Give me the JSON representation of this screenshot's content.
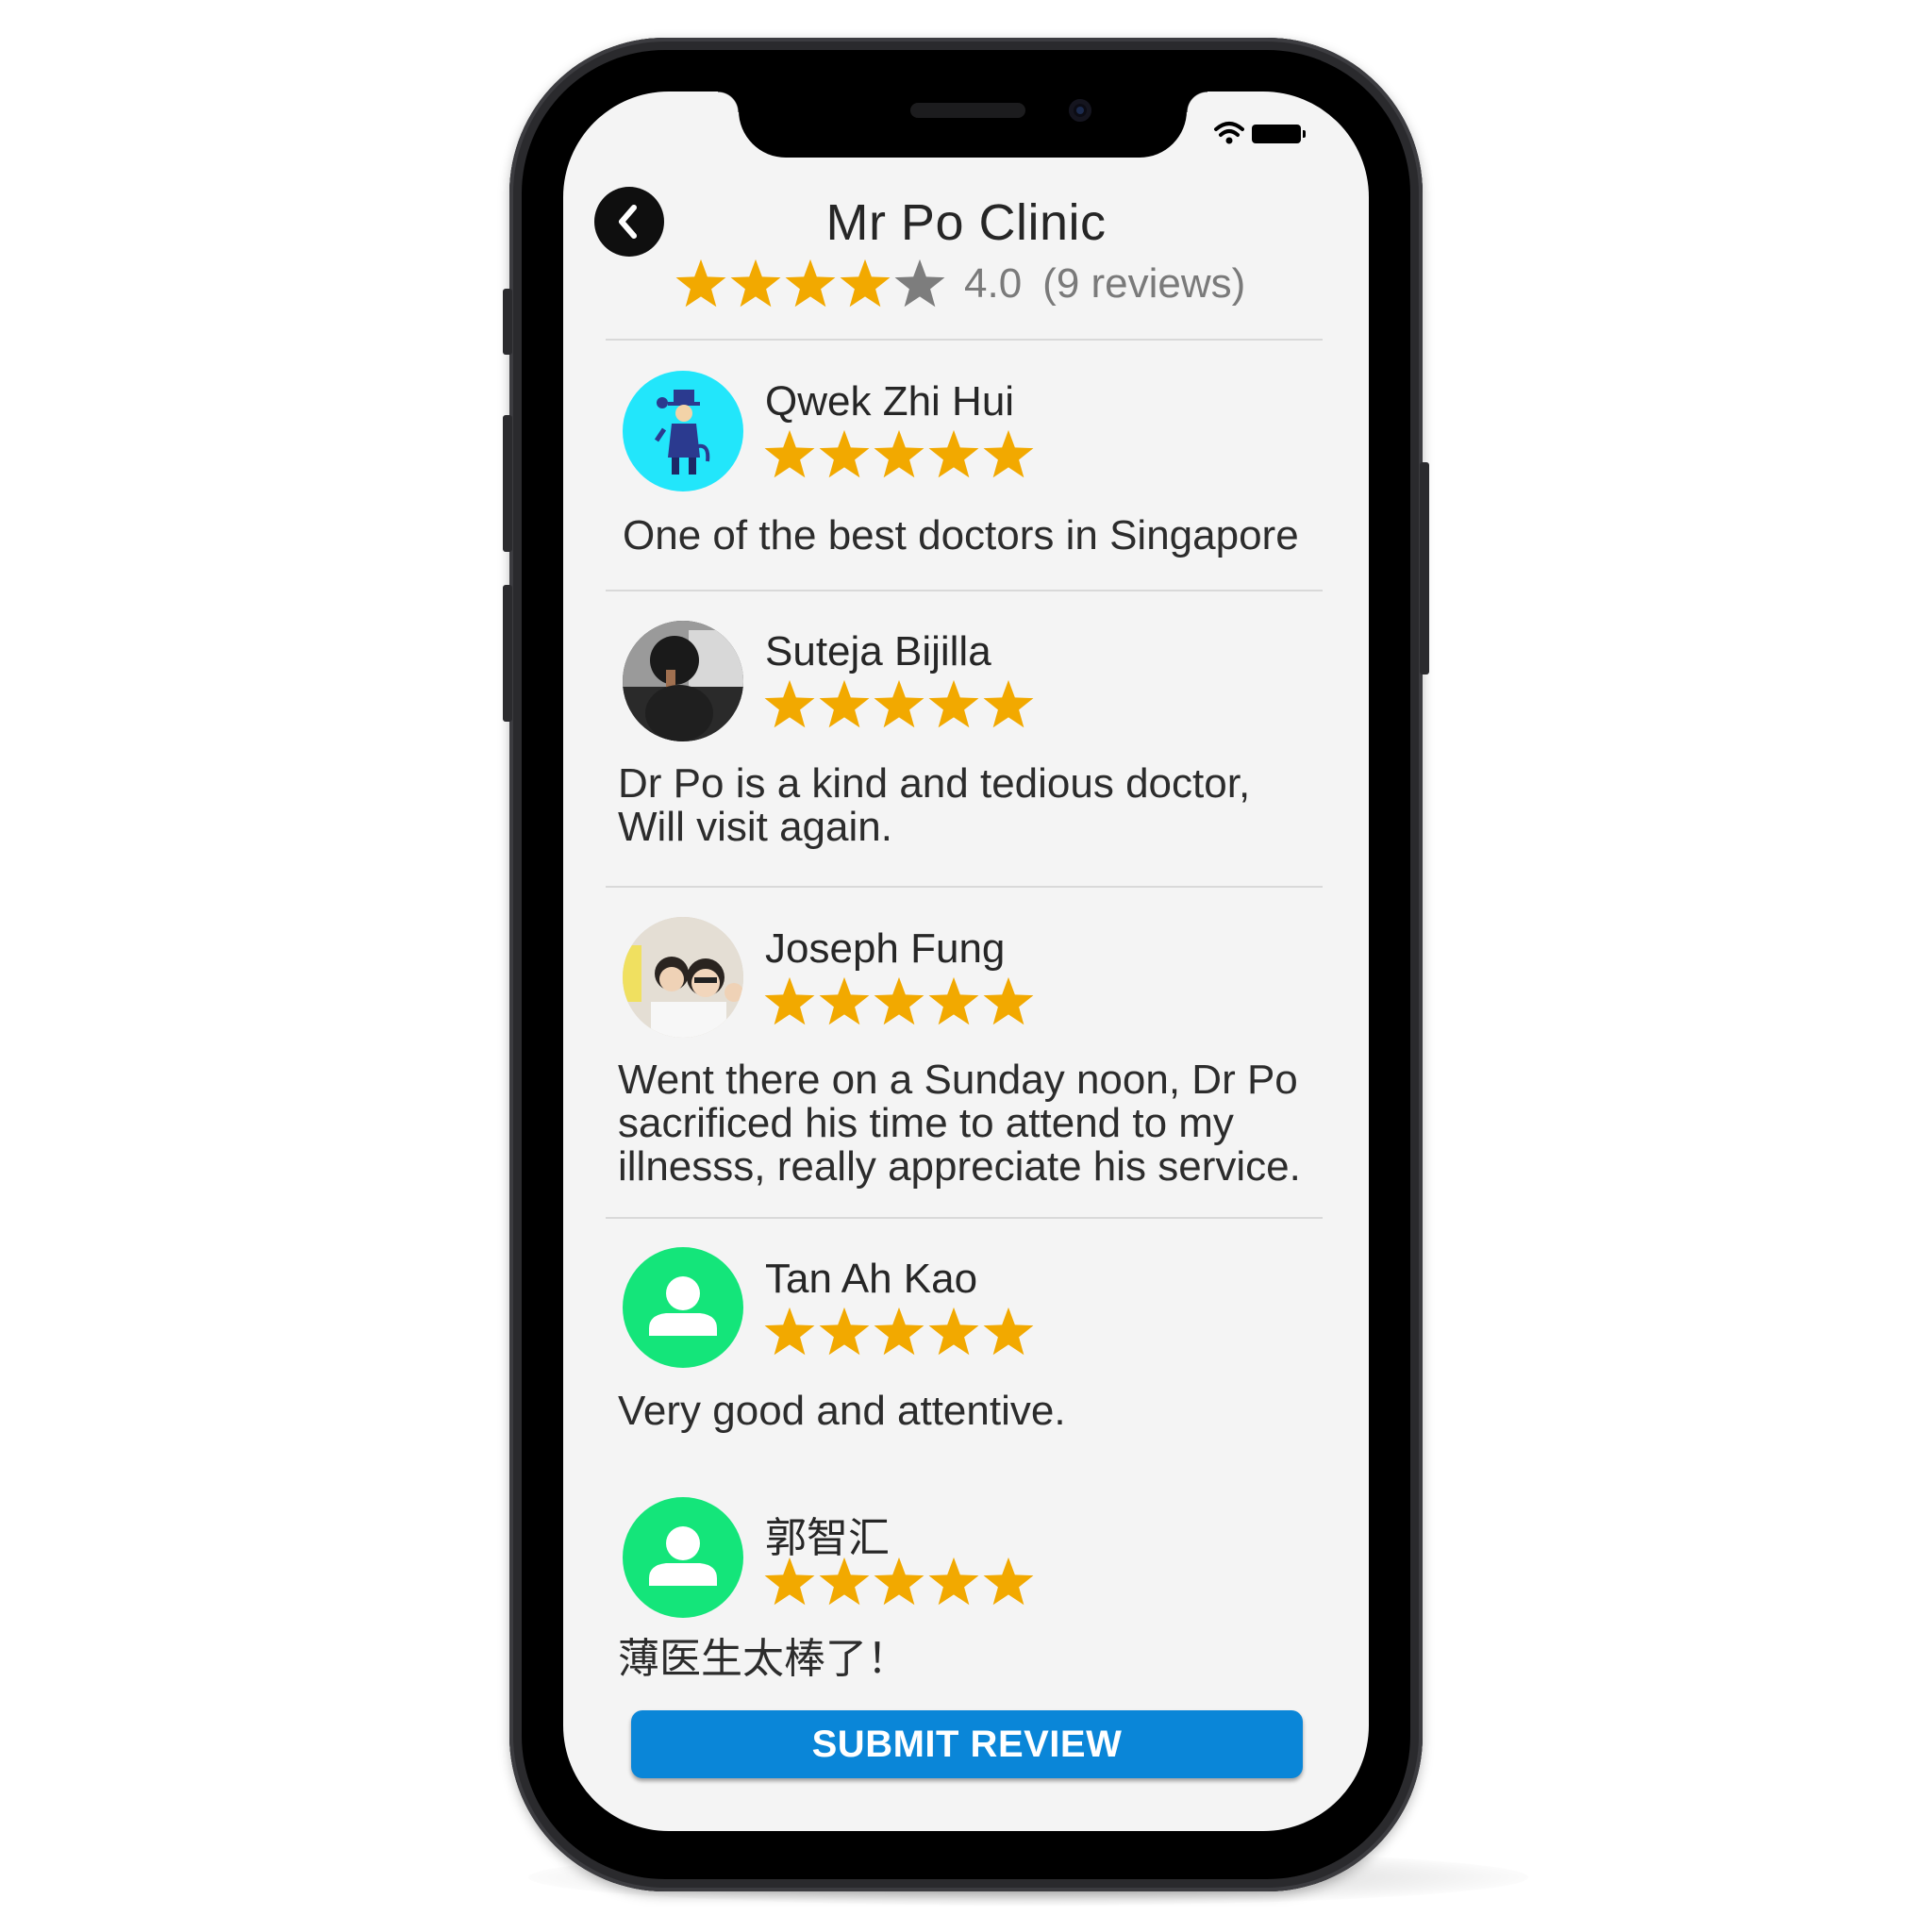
{
  "header": {
    "title": "Mr Po Clinic",
    "rating_text": "4.0",
    "reviews_count_text": "(9 reviews)",
    "rating_value": 4,
    "rating_max": 5
  },
  "colors": {
    "star_filled": "#f2a900",
    "star_empty": "#7d7d7d",
    "accent_button": "#0a86d8",
    "default_avatar": "#14e57a",
    "avatar_cyan": "#22e6fb"
  },
  "reviews": [
    {
      "name": "Qwek Zhi Hui",
      "stars": 5,
      "comment": "One of the best doctors in Singapore",
      "avatar": "cartoon-figure-avatar"
    },
    {
      "name": "Suteja Bijilla",
      "stars": 5,
      "comment_lines": [
        "Dr Po is a kind and tedious doctor,",
        "Will visit again."
      ],
      "avatar": "photo-avatar"
    },
    {
      "name": "Joseph Fung",
      "stars": 5,
      "comment_lines": [
        "Went there on a Sunday noon, Dr Po",
        "sacrificed his time to attend to my",
        "illnesss, really appreciate his service."
      ],
      "avatar": "photo-avatar"
    },
    {
      "name": "Tan Ah Kao",
      "stars": 5,
      "comment": "Very good and attentive.",
      "avatar": "default-user-icon"
    },
    {
      "name": "郭智汇",
      "stars": 5,
      "comment": "薄医生太棒了！",
      "avatar": "default-user-icon"
    }
  ],
  "actions": {
    "submit_label": "SUBMIT REVIEW"
  },
  "icons": {
    "back": "chevron-left-icon",
    "wifi": "wifi-icon",
    "battery": "battery-icon",
    "star": "star-icon",
    "user": "user-icon"
  }
}
